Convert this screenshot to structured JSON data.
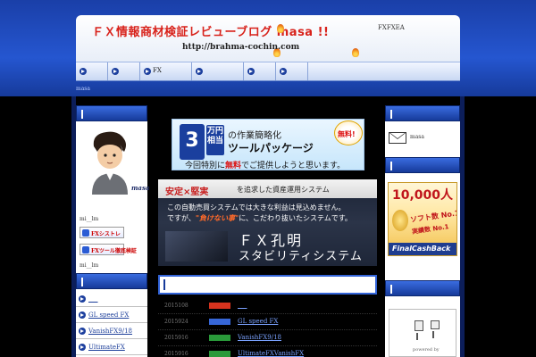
{
  "header": {
    "title": "ＦＸ情報商材検証レビューブログ masa !!",
    "url": "http://brahma-cochin.com",
    "top_text": "FXFXEA"
  },
  "nav": {
    "items": [
      {
        "label": ""
      },
      {
        "label": ""
      },
      {
        "label": "FX"
      },
      {
        "label": ""
      },
      {
        "label": ""
      },
      {
        "label": ""
      }
    ]
  },
  "breadcrumb": "masa",
  "left": {
    "profile_name": "masa",
    "caption1": "mi__lm",
    "banner1": "FXシストレ",
    "banner2": "FXツール徹底検証",
    "caption2": "mi__lm",
    "list": [
      {
        "label": "___"
      },
      {
        "label": "GL speed FX"
      },
      {
        "label": "VanishFX9/18"
      },
      {
        "label": "UltimateFX"
      }
    ]
  },
  "main": {
    "ad1": {
      "big": "3",
      "yen": "万円相当",
      "line1": "の作業簡略化",
      "line2": "ツールパッケージ",
      "line3a": "今回特別に",
      "line3b": "無料",
      "line3c": "でご提供しようと思います。",
      "burst": "無料!"
    },
    "ad2": {
      "head_a": "安定×堅実",
      "head_b": "を追求した資産運用システム",
      "line1": "この自動売買システムでは大きな利益は見込めません。",
      "line2a": "ですが、",
      "line2b": "\"負けない事\"",
      "line2c": "に、こだわり抜いたシステムです。",
      "fx1": "ＦＸ孔明",
      "fx2": "スタビリティシステム"
    },
    "news": [
      {
        "date": "2015108",
        "tag_color": "#d6331e",
        "title": "___"
      },
      {
        "date": "2015924",
        "tag_color": "#3767d8",
        "title": "GL speed FX"
      },
      {
        "date": "2015916",
        "tag_color": "#2a9a3a",
        "title": "VanishFX9/18"
      },
      {
        "date": "2015916",
        "tag_color": "#2a9a3a",
        "title": "UltimateFXVanishFX"
      }
    ]
  },
  "right": {
    "mail_label": "masa",
    "cb_num": "10,000人",
    "cb_line1": "ソフト数 No.1",
    "cb_line2": "実績数 No.1",
    "cb_bottom": "FinalCashBack",
    "powered": "powered by"
  }
}
